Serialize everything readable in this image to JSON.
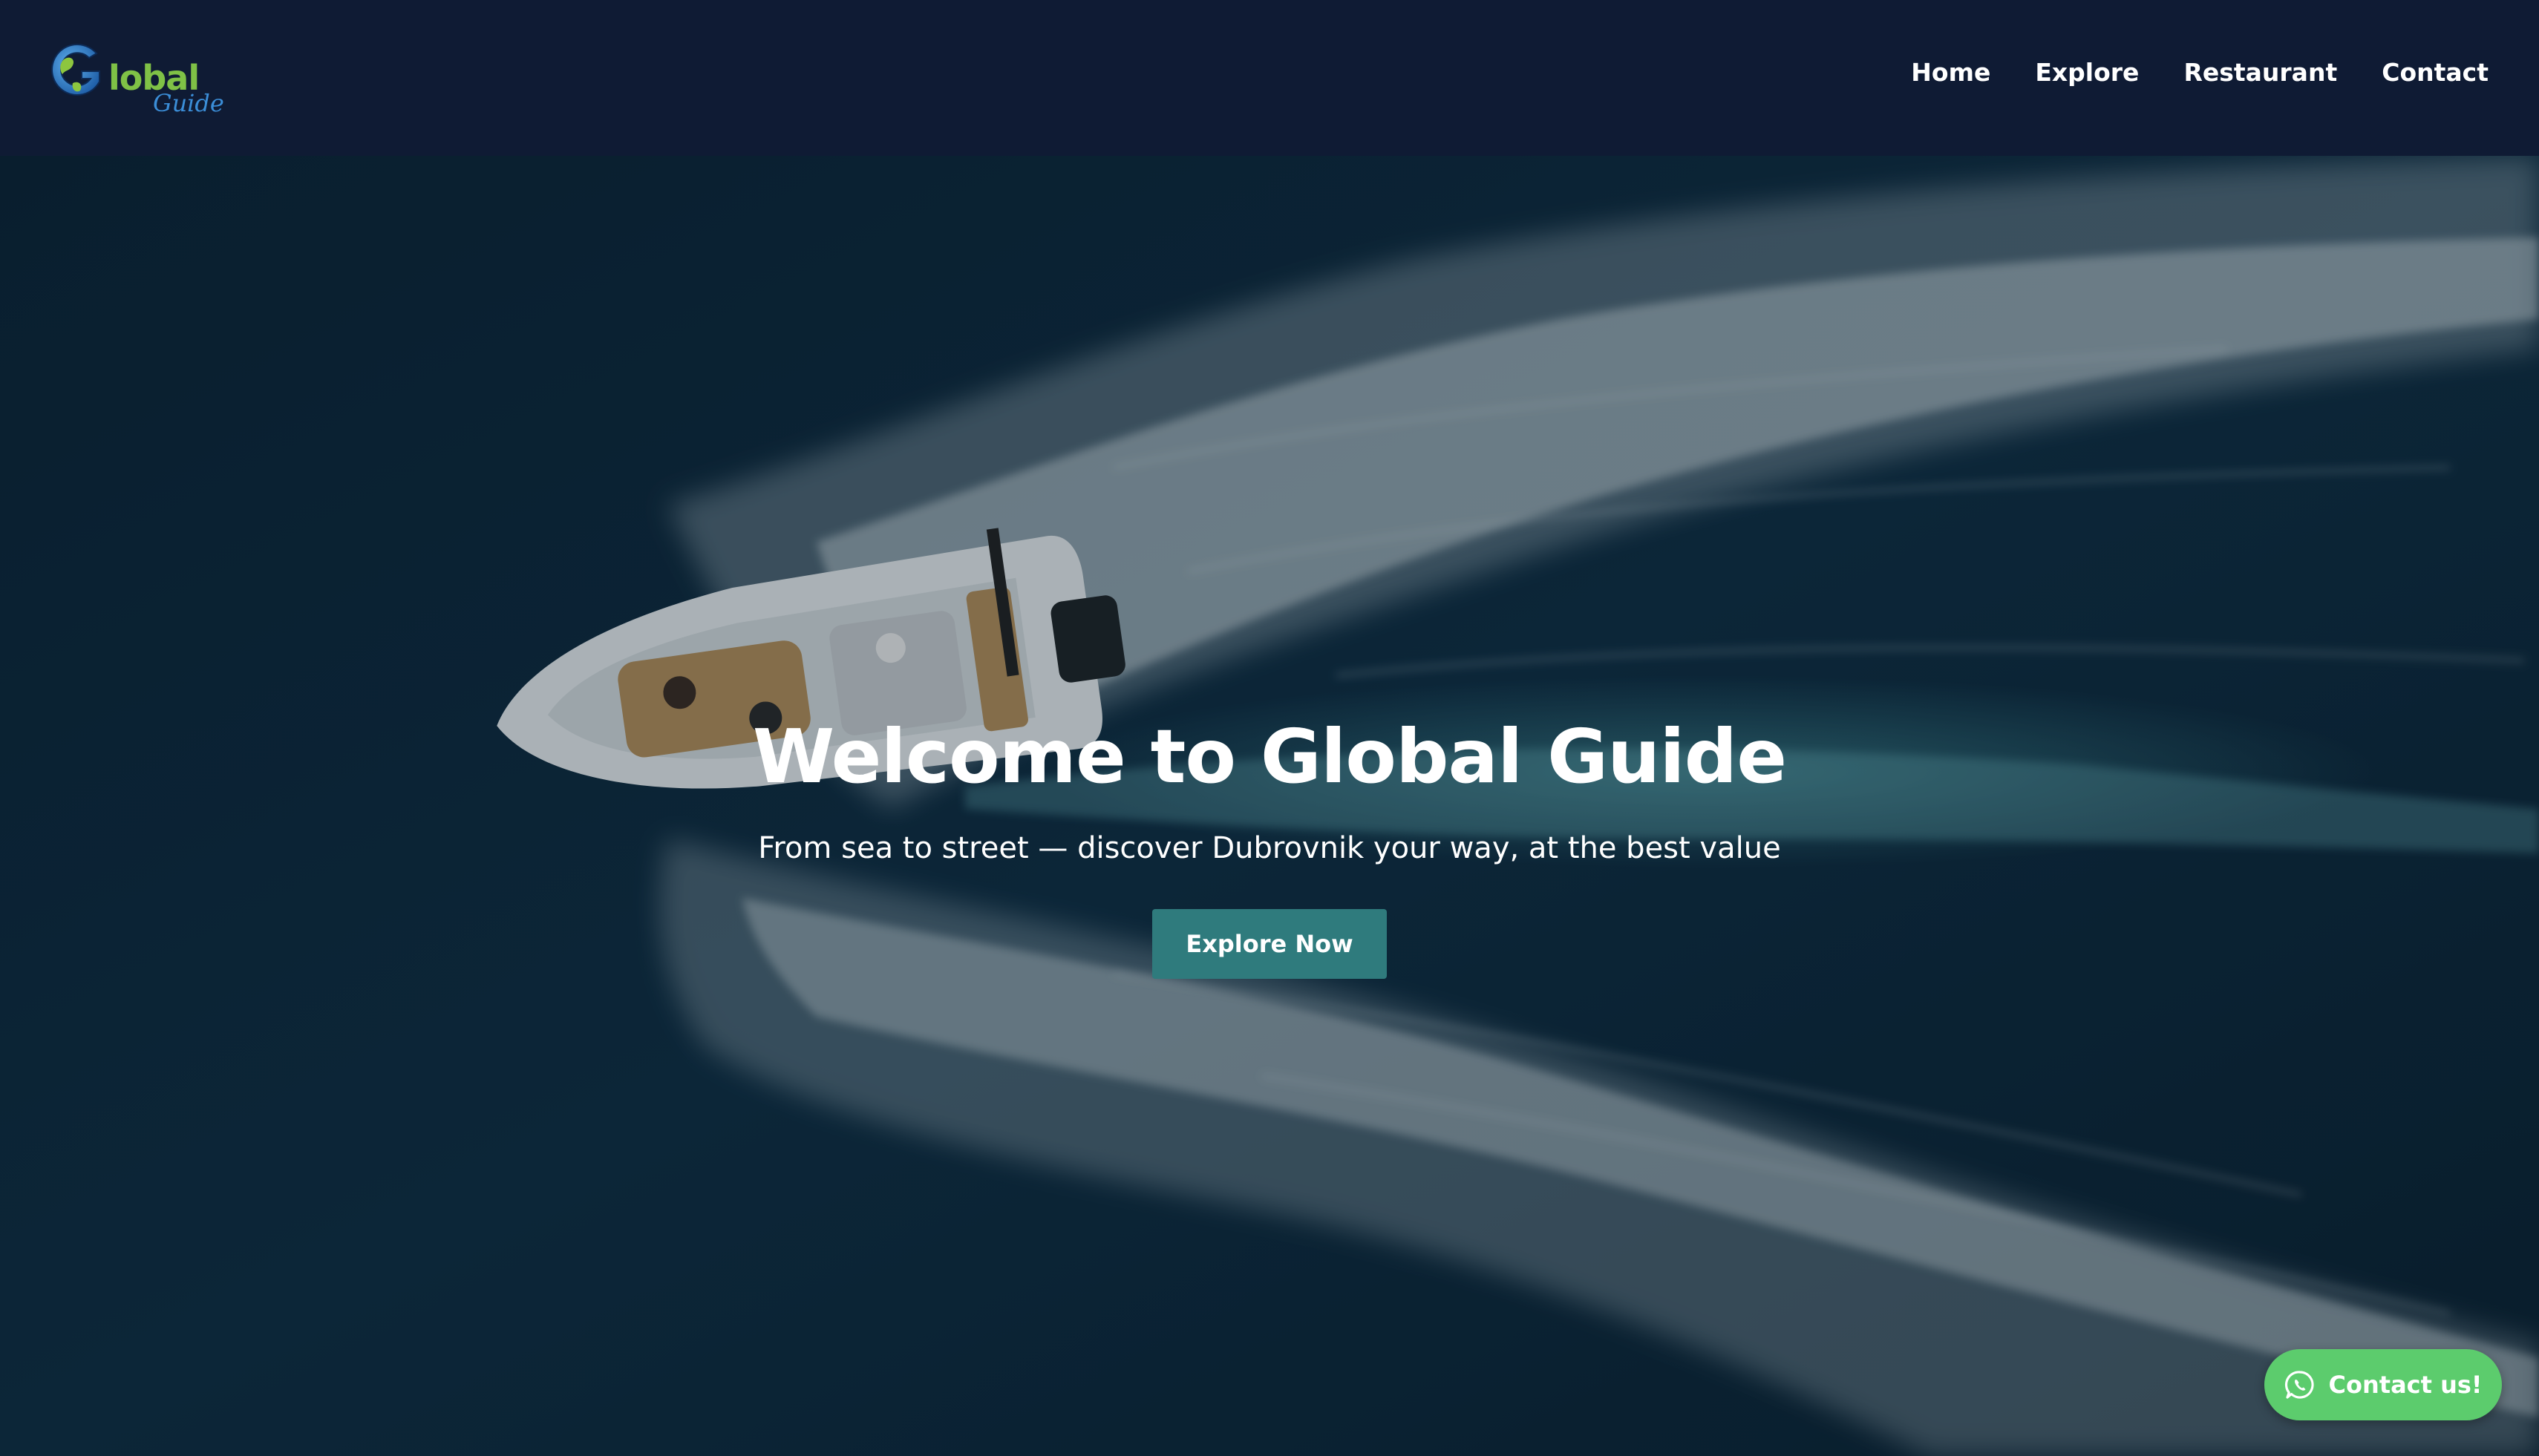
{
  "brand": {
    "logo_word": "lobal",
    "logo_sub": "Guide",
    "logo_letter": "G"
  },
  "nav": {
    "items": [
      {
        "label": "Home"
      },
      {
        "label": "Explore"
      },
      {
        "label": "Restaurant"
      },
      {
        "label": "Contact"
      }
    ]
  },
  "hero": {
    "title": "Welcome to Global Guide",
    "subtitle": "From sea to street — discover Dubrovnik your way, at the best value",
    "cta_label": "Explore Now"
  },
  "contact_fab": {
    "label": "Contact us!",
    "icon": "whatsapp-icon"
  },
  "colors": {
    "header_bg": "#0f1b34",
    "cta_bg": "#2f7b7d",
    "fab_bg": "#5ccc6d",
    "logo_green": "#7fc146",
    "logo_blue": "#3b8ed8"
  }
}
